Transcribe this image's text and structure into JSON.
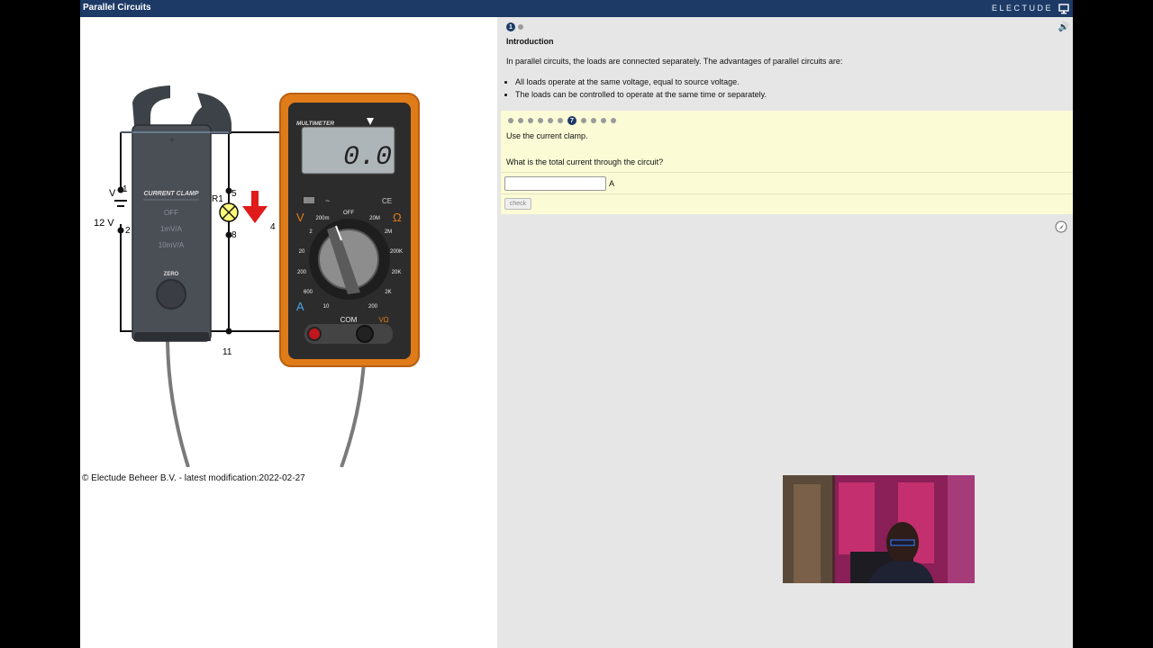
{
  "app": {
    "title": "Parallel Circuits",
    "brand": "ELECTUDE"
  },
  "circuit": {
    "clamp_title": "CURRENT CLAMP",
    "clamp_positions": [
      "OFF",
      "1mV/A",
      "10mV/A"
    ],
    "clamp_zero": "ZERO",
    "voltage_label": "12 V",
    "v_label": "V",
    "node_labels": {
      "n1": "1",
      "n2": "2",
      "n5": "5",
      "n8": "8",
      "n11": "11",
      "n4": "4",
      "r1": "R1"
    },
    "multimeter_title": "MULTIMETER",
    "multimeter_reading": "0.0",
    "multimeter_ce": "CE",
    "dial_labels": [
      "OFF",
      "200m",
      "20M",
      "2M",
      "200K",
      "20K",
      "2K",
      "200",
      "10",
      "600",
      "200",
      "20",
      "2"
    ],
    "mode_labels": {
      "v": "V",
      "ohm": "Ω",
      "a": "A",
      "com": "COM",
      "vohm": "VΩ"
    }
  },
  "copyright": "© Electude Beheer B.V. - latest modification:2022-02-27",
  "intro": {
    "heading": "Introduction",
    "text": "In parallel circuits, the loads are connected separately. The advantages of parallel circuits are:",
    "bullets": [
      "All loads operate at the same voltage, equal to source voltage.",
      "The loads can be controlled to operate at the same time or separately."
    ],
    "page_current": "1"
  },
  "task": {
    "step_current": "7",
    "instruction": "Use the current clamp.",
    "question": "What is the total current through the circuit?",
    "answer_value": "",
    "unit": "A",
    "check_label": "check"
  },
  "colors": {
    "header": "#1d3a66",
    "task_bg": "#fbfbd6",
    "meter_orange": "#e07b1a",
    "arrow": "#e01b1b"
  }
}
